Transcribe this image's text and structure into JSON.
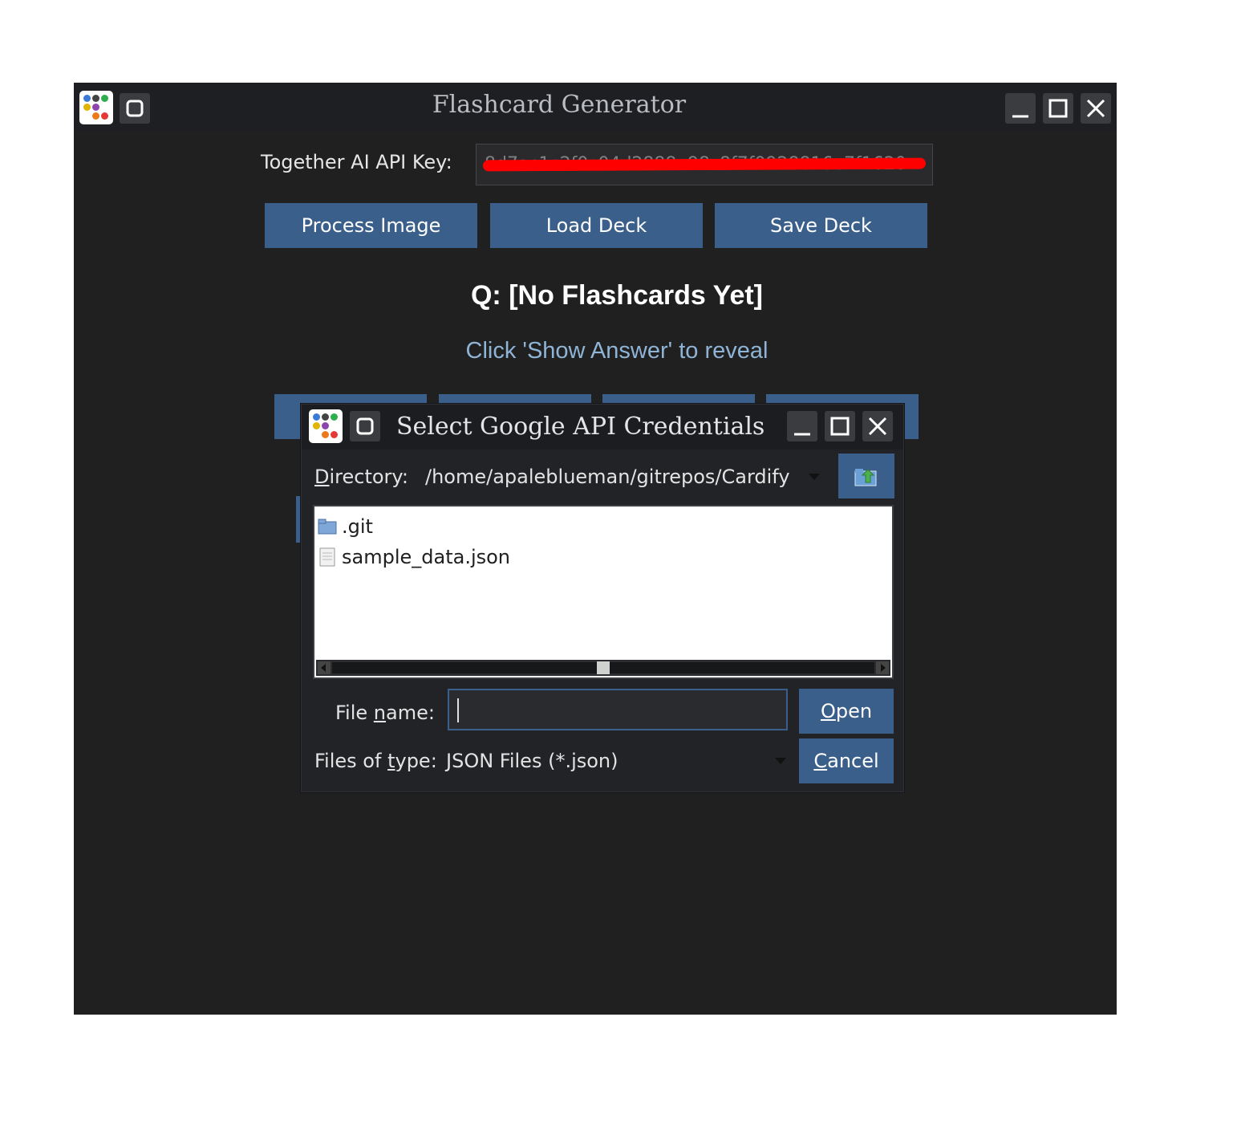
{
  "main_window": {
    "title": "Flashcard Generator",
    "api_key_label": "Together AI API Key:",
    "api_key_value": "8d7ac1c2f0c04d2888e98c8f7f0928816e7f1620",
    "buttons": {
      "process_image": "Process Image",
      "load_deck": "Load Deck",
      "save_deck": "Save Deck"
    },
    "question": "Q: [No Flashcards Yet]",
    "answer_hint": "Click 'Show Answer' to reveal"
  },
  "dialog": {
    "title": "Select Google API Credentials",
    "directory_label": "Directory:",
    "directory_path": "/home/apaleblueman/gitrepos/Cardify",
    "files": [
      {
        "name": ".git",
        "icon": "folder-icon"
      },
      {
        "name": "sample_data.json",
        "icon": "file-icon"
      }
    ],
    "file_name_label": "File name:",
    "file_name_value": "",
    "files_of_type_label": "Files of type:",
    "files_of_type_value": "JSON Files (*.json)",
    "open_button": "Open",
    "cancel_button": "Cancel"
  },
  "colors": {
    "window_bg": "#202020",
    "titlebar_bg": "#1e1f22",
    "button_blue": "#3a5f8a",
    "hint_text": "#8fb4d6",
    "redaction": "#ff0000"
  }
}
